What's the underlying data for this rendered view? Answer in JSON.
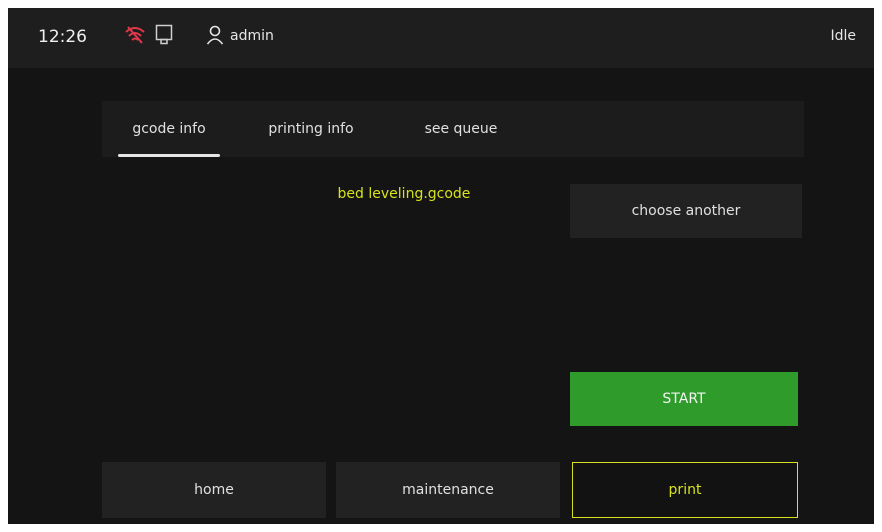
{
  "status": {
    "time": "12:26",
    "user": "admin",
    "state": "Idle",
    "icons": [
      "wifi-disconnected-icon",
      "ethernet-icon",
      "user-icon"
    ],
    "colors": {
      "wifi_alert": "#e0384a"
    }
  },
  "tabs": [
    {
      "label": "gcode info",
      "active": true
    },
    {
      "label": "printing info",
      "active": false
    },
    {
      "label": "see queue",
      "active": false
    }
  ],
  "file": {
    "name": "bed leveling.gcode"
  },
  "actions": {
    "choose_label": "choose another",
    "start_label": "START"
  },
  "nav": [
    {
      "label": "home",
      "active": false
    },
    {
      "label": "maintenance",
      "active": false
    },
    {
      "label": "print",
      "active": true
    }
  ],
  "colors": {
    "accent": "#d7e21c",
    "start": "#2f9b2a",
    "background": "#141414"
  }
}
